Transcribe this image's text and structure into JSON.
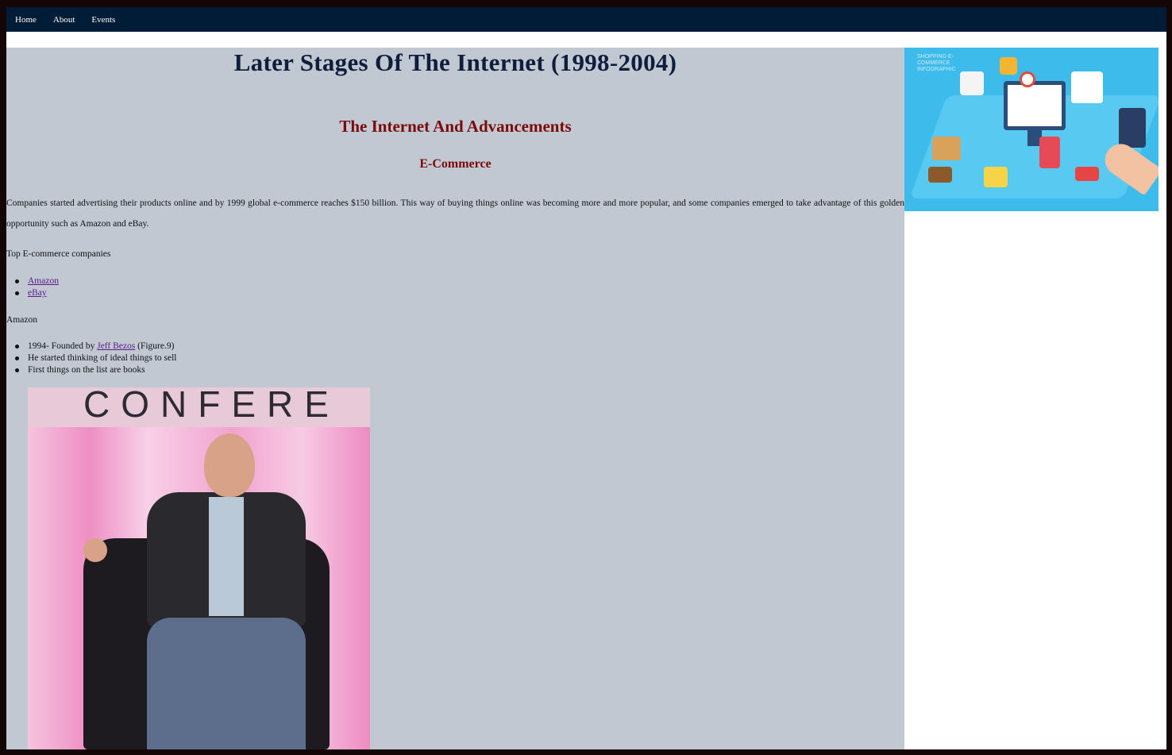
{
  "nav": {
    "items": [
      "Home",
      "About",
      "Events"
    ]
  },
  "page": {
    "title": "Later Stages Of The Internet (1998-2004)",
    "section_title": "The Internet And Advancements",
    "sub_title": "E-Commerce",
    "intro": "Companies started advertising their products online and by 1999 global e-commerce reaches $150 billion. This way of buying things online was becoming more and more popular, and some companies emerged to take advantage of this golden opportunity such as Amazon and eBay."
  },
  "top_companies": {
    "label": "Top E-commerce companies",
    "items": [
      "Amazon",
      "eBay"
    ]
  },
  "amazon": {
    "label": "Amazon",
    "fact1_prefix": "1994- Founded by ",
    "fact1_link": "Jeff Bezos",
    "fact1_suffix": " (Figure.9)",
    "fact2": "He started thinking of ideal things to sell",
    "fact3": "First things on the list are books"
  },
  "photo": {
    "banner_text": "CONFERE"
  },
  "side_image": {
    "caption": "SHOPPING E-COMMERCE INFOGRAPHIC"
  },
  "colors": {
    "navbar": "#011c36",
    "main_bg": "#c1c8d1",
    "title": "#0e1e3c",
    "section": "#7a0a0a",
    "link": "#5a1a8a"
  }
}
